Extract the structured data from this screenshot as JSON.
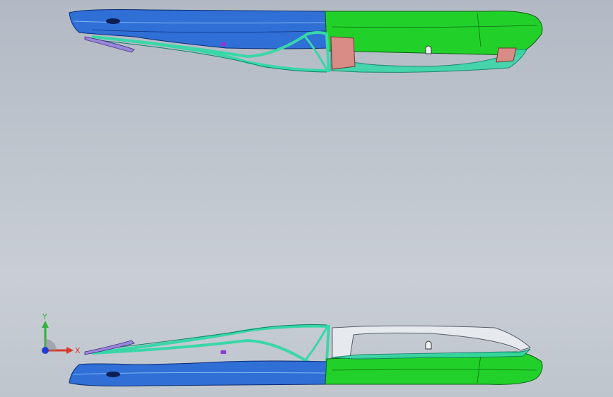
{
  "viewport": {
    "background_top": "#b2b9c4",
    "background_bottom": "#c9ced5"
  },
  "parts": {
    "top_assembly": {
      "name": "part-top-view",
      "colors": {
        "front": "#2f6fd6",
        "rear": "#22d02a",
        "frame": "#39d7a8",
        "bracket": "#d98c86",
        "trim": "#9a86d9"
      }
    },
    "bottom_assembly": {
      "name": "part-bottom-view",
      "colors": {
        "front": "#2f6fd6",
        "rear": "#22d02a",
        "frame": "#39d7a8",
        "trim": "#9a86d9",
        "rail": "#e6e9ee"
      }
    }
  },
  "triad": {
    "x_label": "X",
    "y_label": "Y",
    "x_color": "#d93a2b",
    "y_color": "#2fb33a",
    "origin_color": "#1f3fd6"
  }
}
